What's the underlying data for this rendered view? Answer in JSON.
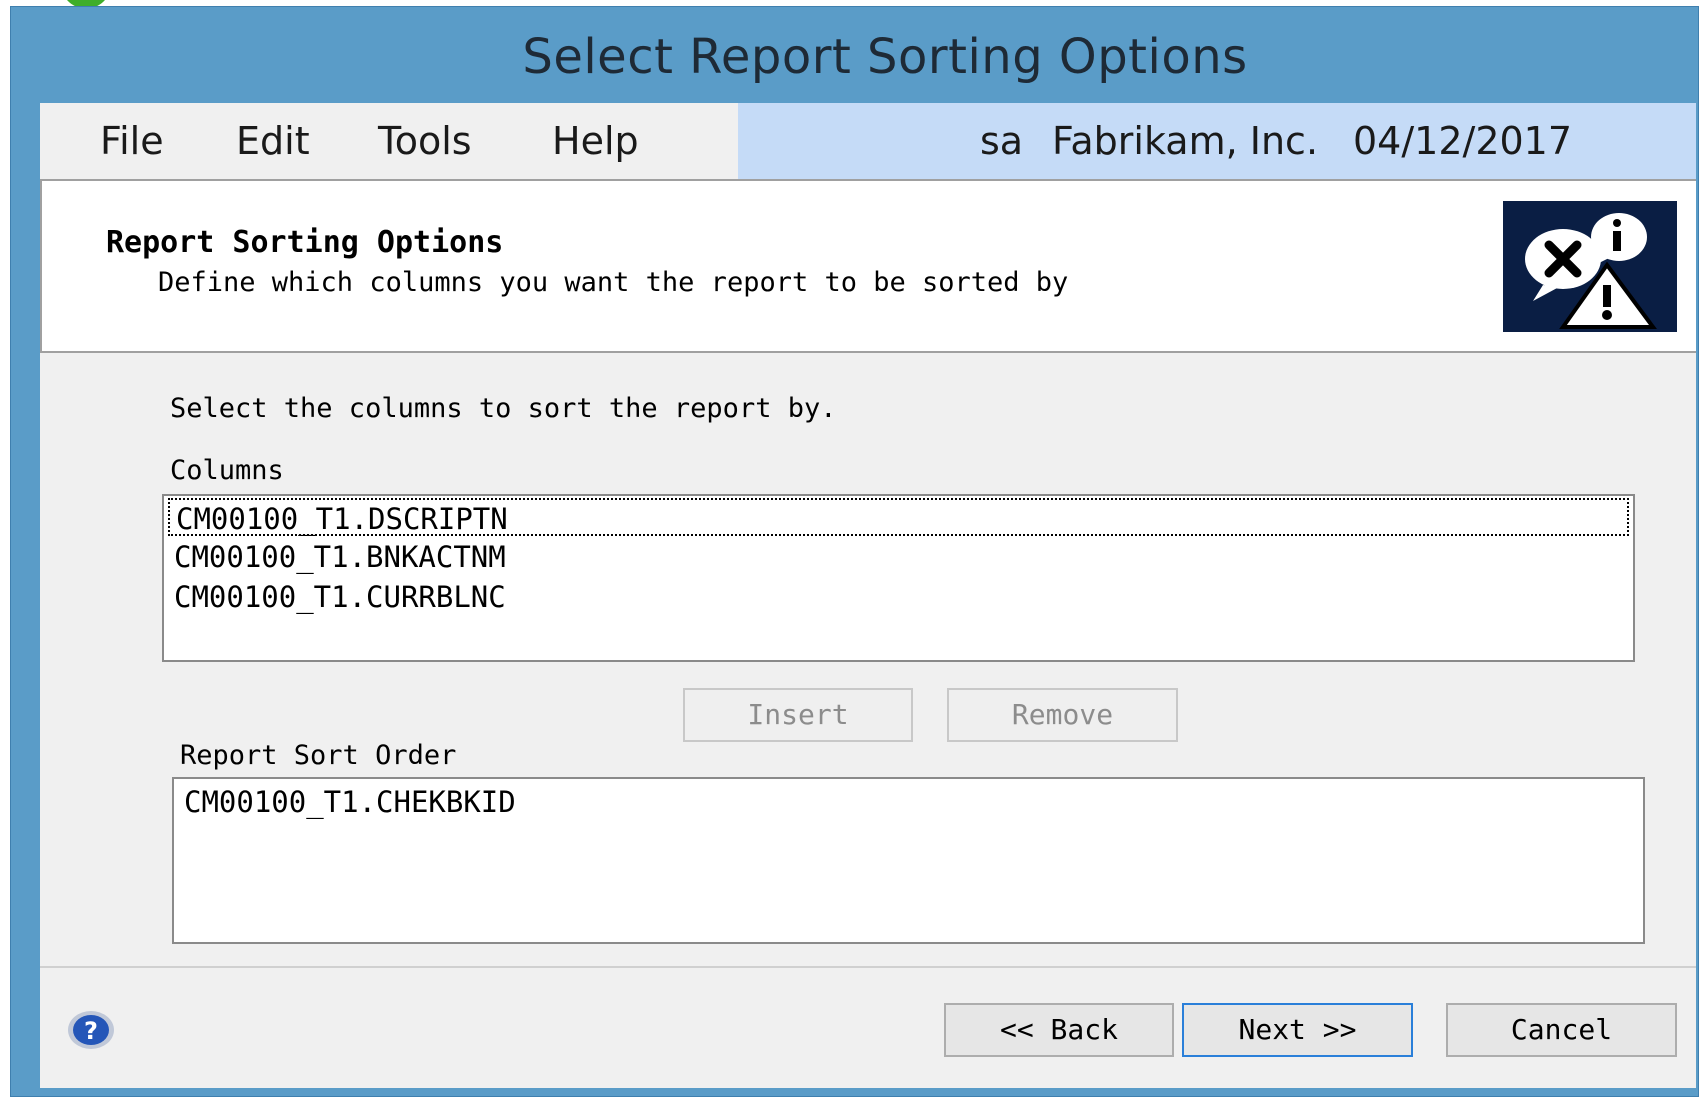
{
  "window": {
    "title": "Select Report Sorting Options"
  },
  "menu": {
    "items": [
      {
        "label": "File"
      },
      {
        "label": "Edit"
      },
      {
        "label": "Tools"
      },
      {
        "label": "Help"
      }
    ]
  },
  "status": {
    "user": "sa",
    "company": "Fabrikam, Inc.",
    "date": "04/12/2017"
  },
  "header": {
    "title": "Report Sorting Options",
    "subtitle": "Define which columns you want the report to be sorted by",
    "icon": "info-warning-error-icon"
  },
  "body": {
    "instruction": "Select the columns to sort the report by.",
    "columns_label": "Columns",
    "columns": [
      "CM00100_T1.DSCRIPTN",
      "CM00100_T1.BNKACTNM",
      "CM00100_T1.CURRBLNC"
    ],
    "insert_label": "Insert",
    "remove_label": "Remove",
    "sort_order_label": "Report Sort Order",
    "sort_order": [
      "CM00100_T1.CHEKBKID"
    ]
  },
  "footer": {
    "help_icon": "help-icon",
    "back_label": "<< Back",
    "next_label": "Next >>",
    "cancel_label": "Cancel"
  },
  "colors": {
    "window_frame": "#5a9cc8",
    "menu_status_bg": "#c5dbf7",
    "icon_bg": "#0a1e44",
    "default_button_border": "#2a7fd9"
  }
}
